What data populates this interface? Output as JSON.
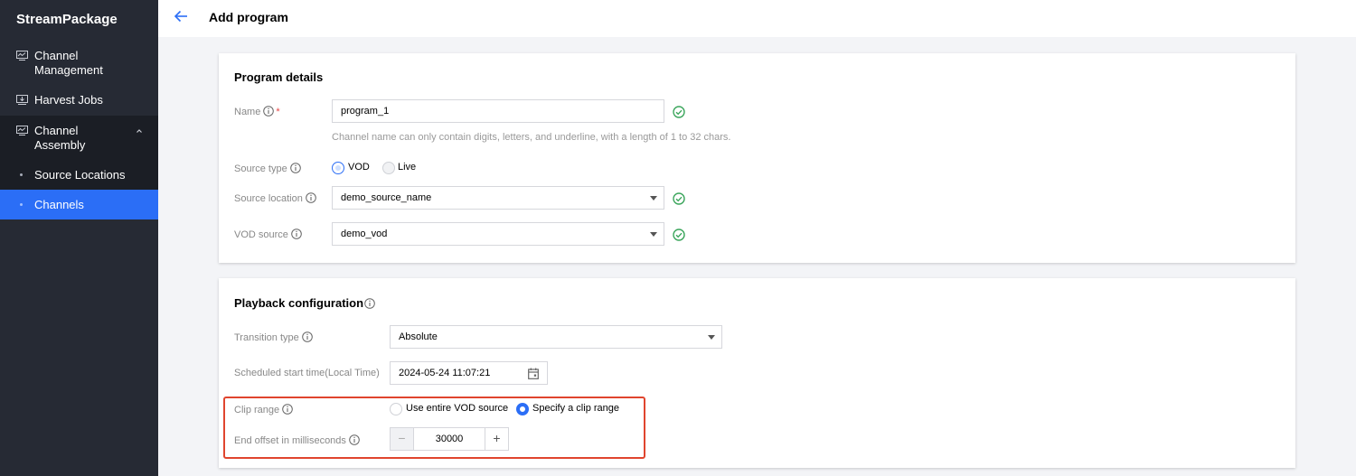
{
  "app": {
    "name": "StreamPackage"
  },
  "sidebar": {
    "items": [
      {
        "label": "Channel Management",
        "lines": [
          "Channel",
          "Management"
        ]
      },
      {
        "label": "Harvest Jobs"
      },
      {
        "label": "Channel Assembly",
        "lines": [
          "Channel",
          "Assembly"
        ]
      },
      {
        "label": "Source Locations"
      },
      {
        "label": "Channels"
      }
    ]
  },
  "header": {
    "title": "Add program"
  },
  "program_details": {
    "title": "Program details",
    "name": {
      "label": "Name",
      "required_mark": "*",
      "value": "program_1",
      "hint": "Channel name can only contain digits, letters, and underline, with a length of 1 to 32 chars."
    },
    "source_type": {
      "label": "Source type",
      "options": [
        "VOD",
        "Live"
      ],
      "selected": "VOD"
    },
    "source_location": {
      "label": "Source location",
      "value": "demo_source_name"
    },
    "vod_source": {
      "label": "VOD source",
      "value": "demo_vod"
    }
  },
  "playback": {
    "title": "Playback configuration",
    "transition_type": {
      "label": "Transition type",
      "value": "Absolute"
    },
    "scheduled_start": {
      "label": "Scheduled start time(Local Time)",
      "value": "2024-05-24 11:07:21"
    },
    "clip_range": {
      "label": "Clip range",
      "options": [
        "Use entire VOD source",
        "Specify a clip range"
      ],
      "selected": "Specify a clip range"
    },
    "end_offset": {
      "label": "End offset in milliseconds",
      "value": "30000",
      "minus": "−",
      "plus": "+"
    }
  },
  "colors": {
    "sidebar_bg": "#262a34",
    "active": "#2b6ef6",
    "success": "#3aa55b",
    "highlight": "#e0452e"
  }
}
